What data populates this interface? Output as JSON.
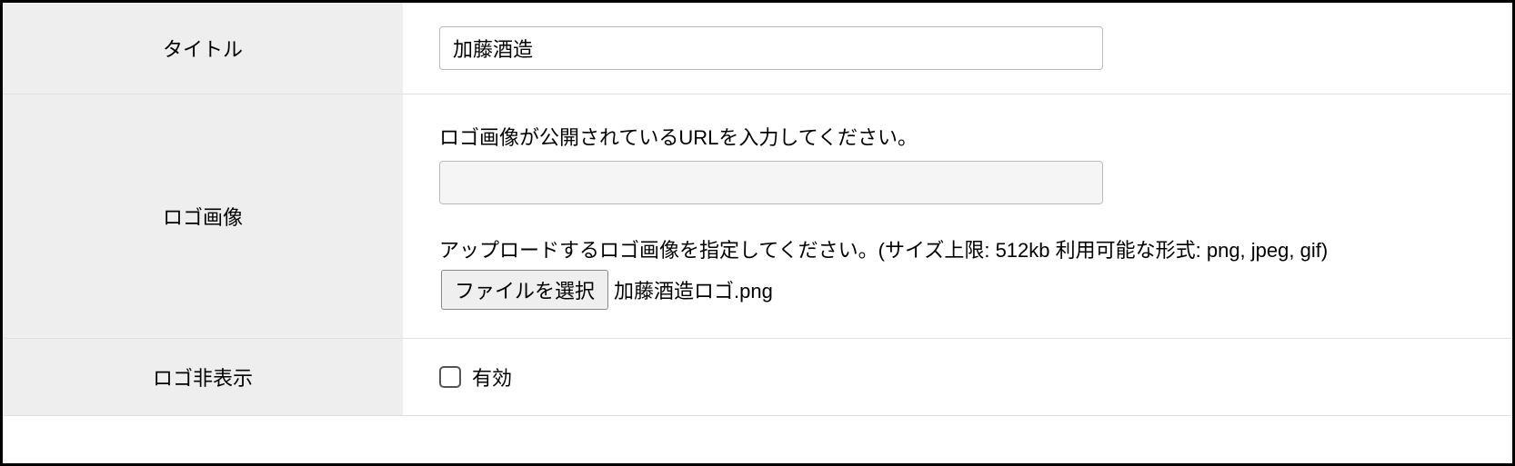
{
  "form": {
    "title": {
      "label": "タイトル",
      "value": "加藤酒造"
    },
    "logo": {
      "label": "ロゴ画像",
      "url_help": "ロゴ画像が公開されているURLを入力してください。",
      "url_value": "",
      "upload_help": "アップロードするロゴ画像を指定してください。(サイズ上限: 512kb 利用可能な形式: png, jpeg, gif) ",
      "file_button": "ファイルを選択",
      "file_name": "加藤酒造ロゴ.png"
    },
    "logo_hide": {
      "label": "ロゴ非表示",
      "checkbox_label": "有効"
    }
  }
}
